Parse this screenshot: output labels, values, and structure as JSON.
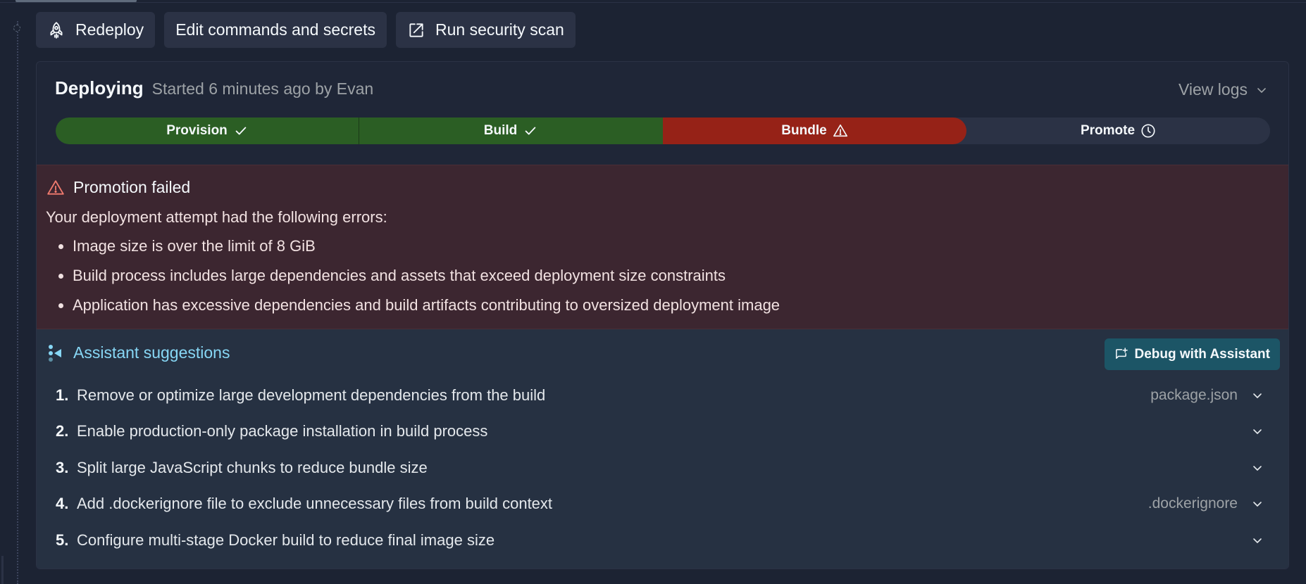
{
  "actions": {
    "redeploy_label": "Redeploy",
    "edit_label": "Edit commands and secrets",
    "scan_label": "Run security scan"
  },
  "deployment": {
    "title": "Deploying",
    "subtitle": "Started 6 minutes ago by Evan",
    "view_logs_label": "View logs",
    "steps": [
      {
        "label": "Provision",
        "status": "success"
      },
      {
        "label": "Build",
        "status": "success"
      },
      {
        "label": "Bundle",
        "status": "failed"
      },
      {
        "label": "Promote",
        "status": "pending"
      }
    ]
  },
  "error": {
    "title": "Promotion failed",
    "intro": "Your deployment attempt had the following errors:",
    "items": [
      "Image size is over the limit of 8 GiB",
      "Build process includes large dependencies and assets that exceed deployment size constraints",
      "Application has excessive dependencies and build artifacts contributing to oversized deployment image"
    ]
  },
  "assistant": {
    "title": "Assistant suggestions",
    "debug_label": "Debug with Assistant",
    "suggestions": [
      {
        "num": "1.",
        "text": "Remove or optimize large development dependencies from the build",
        "file": "package.json"
      },
      {
        "num": "2.",
        "text": "Enable production-only package installation in build process",
        "file": ""
      },
      {
        "num": "3.",
        "text": "Split large JavaScript chunks to reduce bundle size",
        "file": ""
      },
      {
        "num": "4.",
        "text": "Add .dockerignore file to exclude unnecessary files from build context",
        "file": ".dockerignore"
      },
      {
        "num": "5.",
        "text": "Configure multi-stage Docker build to reduce final image size",
        "file": ""
      }
    ]
  },
  "colors": {
    "background": "#1c2333",
    "success": "#2b5e24",
    "failed": "#962217",
    "pending": "#2b3245",
    "error_panel": "#3c2630",
    "assistant_accent": "#87d7f5",
    "debug_button": "#1c5566"
  },
  "icons": {
    "redeploy": "rocket-icon",
    "scan": "external-link-icon",
    "success": "check-icon",
    "failed": "warning-icon",
    "pending": "clock-icon",
    "assistant": "assistant-icon",
    "debug": "chat-plus-icon",
    "expand": "chevron-down-icon"
  }
}
